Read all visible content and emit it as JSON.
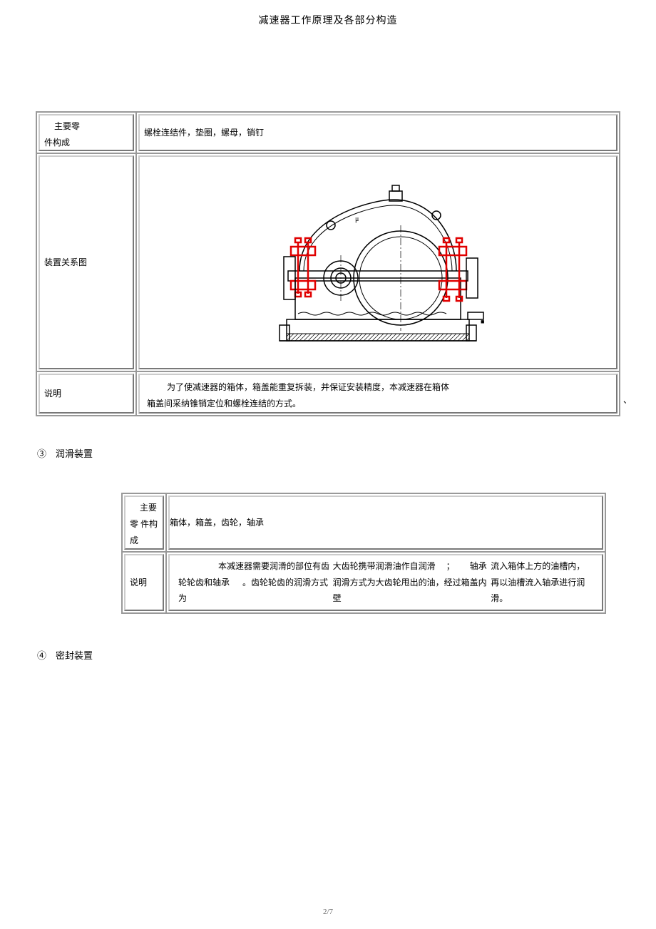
{
  "header": {
    "title": "减速器工作原理及各部分构造"
  },
  "table1": {
    "row1": {
      "label_line1": "主要零",
      "label_line2": "件构成",
      "value": "螺栓连结件，垫圈，螺母，销钉"
    },
    "row2": {
      "label": "装置关系图"
    },
    "row3": {
      "label": "说明",
      "value_line1": "为了使减速器的箱体，箱盖能重复拆装，并保证安装精度，本减速器在箱体",
      "value_line2": "箱盖间采纳锥销定位和螺栓连结的方式。",
      "overhang": "、"
    }
  },
  "section3": {
    "marker": "③",
    "title": "润滑装置"
  },
  "table2": {
    "row1": {
      "label_line1": "主要",
      "label_line2_left": "零 件构",
      "label_line2_right": "箱体，箱盖，齿轮，轴承",
      "label_line3": "成"
    },
    "row2": {
      "label": "说明",
      "line1_a": "本减速器需要润滑的部位有齿轮轮齿和轴承",
      "line1_b": "。齿轮轮齿的润滑方式为",
      "line2_a": "大齿轮携带润滑油作自润滑",
      "line2_b": "；",
      "line2_c": "轴承润滑方式为大齿轮甩出的油，经过箱盖内壁",
      "line3": "流入箱体上方的油槽内，再以油槽流入轴承进行润滑。"
    }
  },
  "section4": {
    "marker": "④",
    "title": "密封装置"
  },
  "footer": {
    "page": "2/7"
  }
}
